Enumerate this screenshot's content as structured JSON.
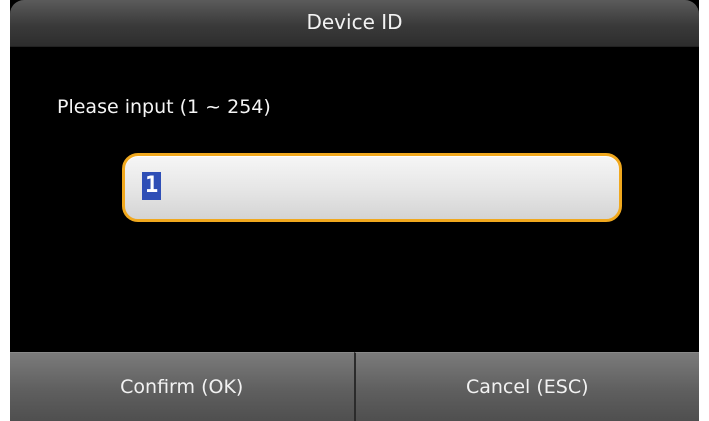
{
  "header": {
    "title": "Device ID"
  },
  "prompt": {
    "text": "Please input (1 ~ 254)"
  },
  "input": {
    "value": "1"
  },
  "footer": {
    "confirm_label": "Confirm (OK)",
    "cancel_label": "Cancel (ESC)"
  },
  "colors": {
    "input_border": "#f0a81e",
    "selection": "#2f4fb6",
    "background": "#000000"
  }
}
